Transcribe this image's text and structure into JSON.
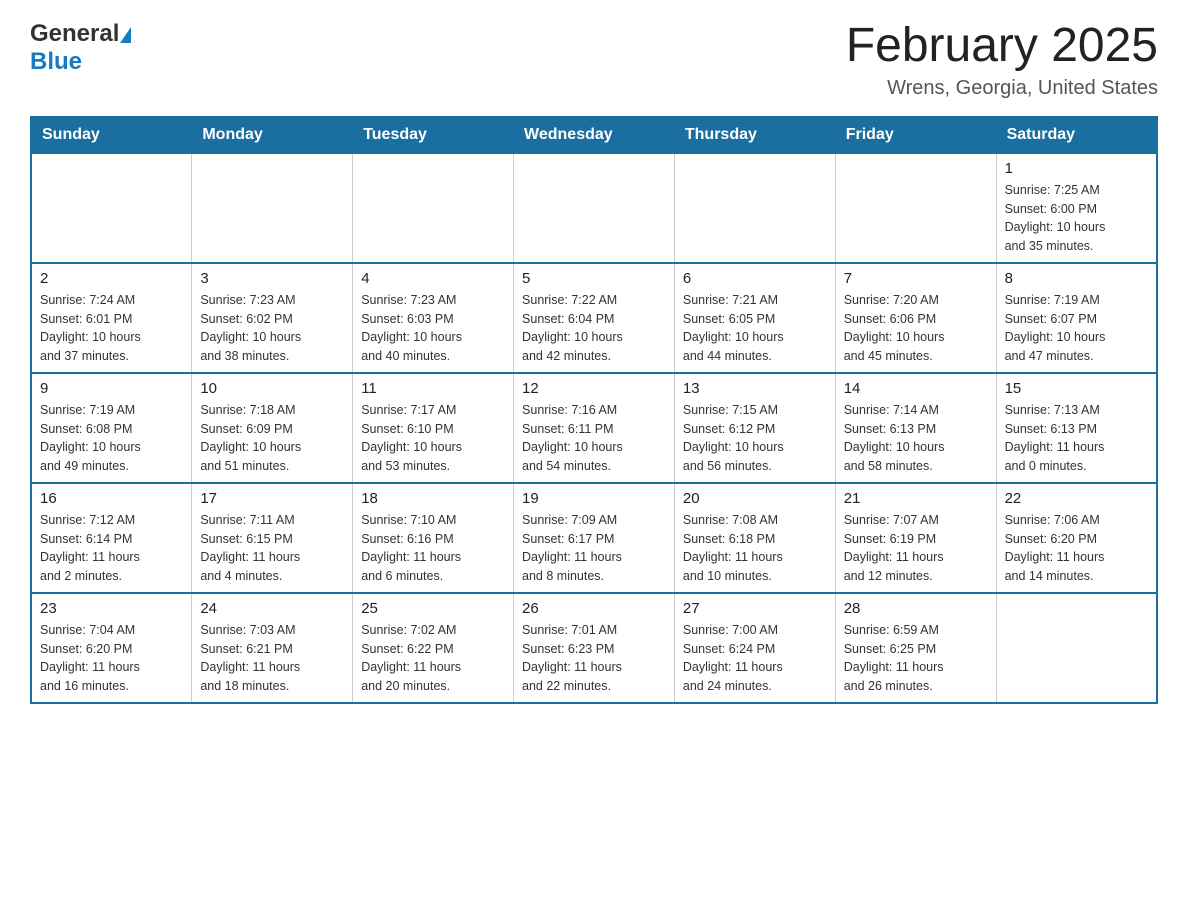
{
  "header": {
    "logo_general": "General",
    "logo_blue": "Blue",
    "month_title": "February 2025",
    "location": "Wrens, Georgia, United States"
  },
  "days_of_week": [
    "Sunday",
    "Monday",
    "Tuesday",
    "Wednesday",
    "Thursday",
    "Friday",
    "Saturday"
  ],
  "weeks": [
    [
      {
        "day": "",
        "info": ""
      },
      {
        "day": "",
        "info": ""
      },
      {
        "day": "",
        "info": ""
      },
      {
        "day": "",
        "info": ""
      },
      {
        "day": "",
        "info": ""
      },
      {
        "day": "",
        "info": ""
      },
      {
        "day": "1",
        "info": "Sunrise: 7:25 AM\nSunset: 6:00 PM\nDaylight: 10 hours\nand 35 minutes."
      }
    ],
    [
      {
        "day": "2",
        "info": "Sunrise: 7:24 AM\nSunset: 6:01 PM\nDaylight: 10 hours\nand 37 minutes."
      },
      {
        "day": "3",
        "info": "Sunrise: 7:23 AM\nSunset: 6:02 PM\nDaylight: 10 hours\nand 38 minutes."
      },
      {
        "day": "4",
        "info": "Sunrise: 7:23 AM\nSunset: 6:03 PM\nDaylight: 10 hours\nand 40 minutes."
      },
      {
        "day": "5",
        "info": "Sunrise: 7:22 AM\nSunset: 6:04 PM\nDaylight: 10 hours\nand 42 minutes."
      },
      {
        "day": "6",
        "info": "Sunrise: 7:21 AM\nSunset: 6:05 PM\nDaylight: 10 hours\nand 44 minutes."
      },
      {
        "day": "7",
        "info": "Sunrise: 7:20 AM\nSunset: 6:06 PM\nDaylight: 10 hours\nand 45 minutes."
      },
      {
        "day": "8",
        "info": "Sunrise: 7:19 AM\nSunset: 6:07 PM\nDaylight: 10 hours\nand 47 minutes."
      }
    ],
    [
      {
        "day": "9",
        "info": "Sunrise: 7:19 AM\nSunset: 6:08 PM\nDaylight: 10 hours\nand 49 minutes."
      },
      {
        "day": "10",
        "info": "Sunrise: 7:18 AM\nSunset: 6:09 PM\nDaylight: 10 hours\nand 51 minutes."
      },
      {
        "day": "11",
        "info": "Sunrise: 7:17 AM\nSunset: 6:10 PM\nDaylight: 10 hours\nand 53 minutes."
      },
      {
        "day": "12",
        "info": "Sunrise: 7:16 AM\nSunset: 6:11 PM\nDaylight: 10 hours\nand 54 minutes."
      },
      {
        "day": "13",
        "info": "Sunrise: 7:15 AM\nSunset: 6:12 PM\nDaylight: 10 hours\nand 56 minutes."
      },
      {
        "day": "14",
        "info": "Sunrise: 7:14 AM\nSunset: 6:13 PM\nDaylight: 10 hours\nand 58 minutes."
      },
      {
        "day": "15",
        "info": "Sunrise: 7:13 AM\nSunset: 6:13 PM\nDaylight: 11 hours\nand 0 minutes."
      }
    ],
    [
      {
        "day": "16",
        "info": "Sunrise: 7:12 AM\nSunset: 6:14 PM\nDaylight: 11 hours\nand 2 minutes."
      },
      {
        "day": "17",
        "info": "Sunrise: 7:11 AM\nSunset: 6:15 PM\nDaylight: 11 hours\nand 4 minutes."
      },
      {
        "day": "18",
        "info": "Sunrise: 7:10 AM\nSunset: 6:16 PM\nDaylight: 11 hours\nand 6 minutes."
      },
      {
        "day": "19",
        "info": "Sunrise: 7:09 AM\nSunset: 6:17 PM\nDaylight: 11 hours\nand 8 minutes."
      },
      {
        "day": "20",
        "info": "Sunrise: 7:08 AM\nSunset: 6:18 PM\nDaylight: 11 hours\nand 10 minutes."
      },
      {
        "day": "21",
        "info": "Sunrise: 7:07 AM\nSunset: 6:19 PM\nDaylight: 11 hours\nand 12 minutes."
      },
      {
        "day": "22",
        "info": "Sunrise: 7:06 AM\nSunset: 6:20 PM\nDaylight: 11 hours\nand 14 minutes."
      }
    ],
    [
      {
        "day": "23",
        "info": "Sunrise: 7:04 AM\nSunset: 6:20 PM\nDaylight: 11 hours\nand 16 minutes."
      },
      {
        "day": "24",
        "info": "Sunrise: 7:03 AM\nSunset: 6:21 PM\nDaylight: 11 hours\nand 18 minutes."
      },
      {
        "day": "25",
        "info": "Sunrise: 7:02 AM\nSunset: 6:22 PM\nDaylight: 11 hours\nand 20 minutes."
      },
      {
        "day": "26",
        "info": "Sunrise: 7:01 AM\nSunset: 6:23 PM\nDaylight: 11 hours\nand 22 minutes."
      },
      {
        "day": "27",
        "info": "Sunrise: 7:00 AM\nSunset: 6:24 PM\nDaylight: 11 hours\nand 24 minutes."
      },
      {
        "day": "28",
        "info": "Sunrise: 6:59 AM\nSunset: 6:25 PM\nDaylight: 11 hours\nand 26 minutes."
      },
      {
        "day": "",
        "info": ""
      }
    ]
  ]
}
